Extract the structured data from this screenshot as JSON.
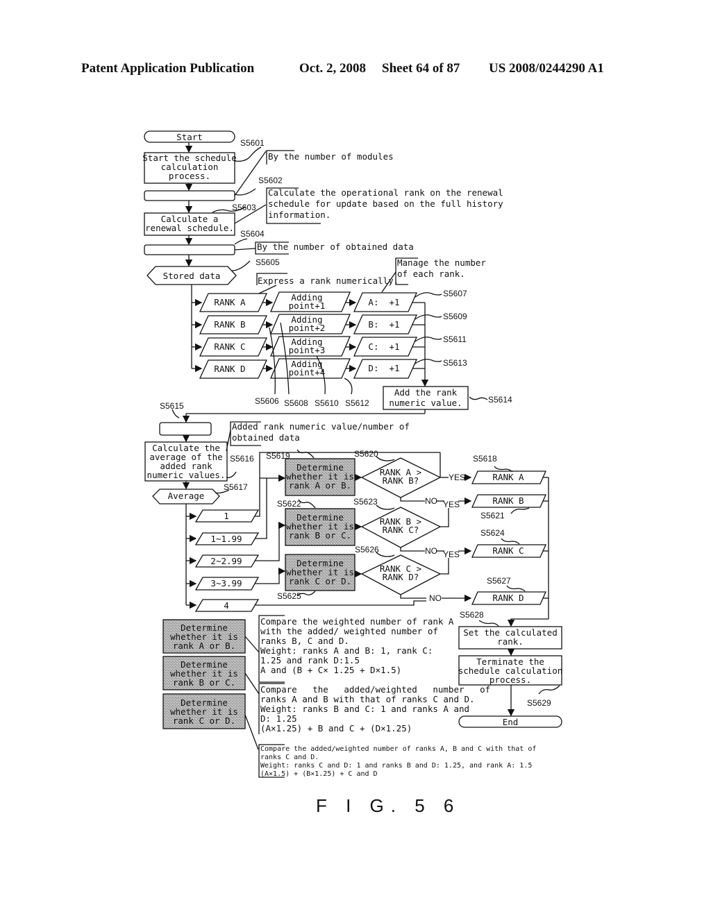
{
  "header": {
    "publication": "Patent Application Publication",
    "date": "Oct. 2, 2008",
    "sheet": "Sheet 64 of 87",
    "number": "US 2008/0244290 A1"
  },
  "figure_label": "F I G. 5 6",
  "nodes": {
    "start": "Start",
    "s5601_lines": [
      "Start the schedule",
      "calculation",
      "process."
    ],
    "s5603_lines": [
      "Calculate a",
      "renewal schedule."
    ],
    "stored_data": "Stored data",
    "ranks": [
      "RANK A",
      "RANK B",
      "RANK C",
      "RANK D"
    ],
    "adding": [
      [
        "Adding",
        "point+1"
      ],
      [
        "Adding",
        "point+2"
      ],
      [
        "Adding",
        "point+3"
      ],
      [
        "Adding",
        "point+4"
      ]
    ],
    "counts": [
      "A:  +1",
      "B:  +1",
      "C:  +1",
      "D:  +1"
    ],
    "s5614_lines": [
      "Add the rank",
      "numeric value."
    ],
    "s5616_lines": [
      "Calculate the",
      "average of the",
      "added rank",
      "numeric values."
    ],
    "average": "Average",
    "ranges": [
      "1",
      "1~1.99",
      "2~2.99",
      "3~3.99",
      "4"
    ],
    "determine_ab": [
      "Determine",
      "whether it is",
      "rank A or B."
    ],
    "determine_bc": [
      "Determine",
      "whether it is",
      "rank B or C."
    ],
    "determine_cd": [
      "Determine",
      "whether it is",
      "rank C or D."
    ],
    "diamond_ab": [
      "RANK A >",
      "RANK B?"
    ],
    "diamond_bc": [
      "RANK B >",
      "RANK C?"
    ],
    "diamond_cd": [
      "RANK C >",
      "RANK D?"
    ],
    "result_ranks": [
      "RANK A",
      "RANK B",
      "RANK C",
      "RANK D"
    ],
    "yes": "YES",
    "no": "NO",
    "s5628_lines": [
      "Set the calculated",
      "rank."
    ],
    "s5629_lines": [
      "Terminate the",
      "schedule calculation",
      "process."
    ],
    "end": "End"
  },
  "step_labels": {
    "s5601": "S5601",
    "s5602": "S5602",
    "s5603": "S5603",
    "s5604": "S5604",
    "s5605": "S5605",
    "s5606": "S5606",
    "s5607": "S5607",
    "s5608": "S5608",
    "s5609": "S5609",
    "s5610": "S5610",
    "s5611": "S5611",
    "s5612": "S5612",
    "s5613": "S5613",
    "s5614": "S5614",
    "s5615": "S5615",
    "s5616": "S5616",
    "s5617": "S5617",
    "s5618": "S5618",
    "s5619": "S5619",
    "s5620": "S5620",
    "s5621": "S5621",
    "s5622": "S5622",
    "s5623": "S5623",
    "s5624": "S5624",
    "s5625": "S5625",
    "s5626": "S5626",
    "s5627": "S5627",
    "s5628": "S5628",
    "s5629": "S5629"
  },
  "notes": {
    "by_modules": "By the number of modules",
    "operational_rank": [
      "Calculate the operational rank on the renewal",
      "schedule for update based on the full history",
      "information."
    ],
    "by_obtained": "By the number of obtained data",
    "express_rank": "Express a rank numerically.",
    "manage_number": [
      "Manage the number",
      "of each rank."
    ],
    "added_rank": [
      "Added rank numeric value/number of",
      "obtained data"
    ],
    "compare_ab": [
      "Compare the weighted number of rank A",
      "with the added/ weighted number of",
      "ranks B, C and D.",
      "Weight: ranks A and B: 1, rank C:",
      "1.25 and rank D:1.5",
      "A and (B + C× 1.25 + D×1.5)"
    ],
    "compare_bc": [
      "Compare   the   added/weighted   number   of",
      "ranks A and B with that of ranks C and D.",
      "Weight: ranks B and C: 1 and ranks A and",
      "D: 1.25",
      "(A×1.25) + B and C + (D×1.25)"
    ],
    "compare_cd": [
      "Compare the added/weighted number of ranks A, B and C with that of",
      "ranks C and D.",
      "Weight: ranks C and D: 1 and ranks B and D: 1.25, and rank A: 1.5",
      "(A×1.5) + (B×1.25) + C and D"
    ]
  }
}
